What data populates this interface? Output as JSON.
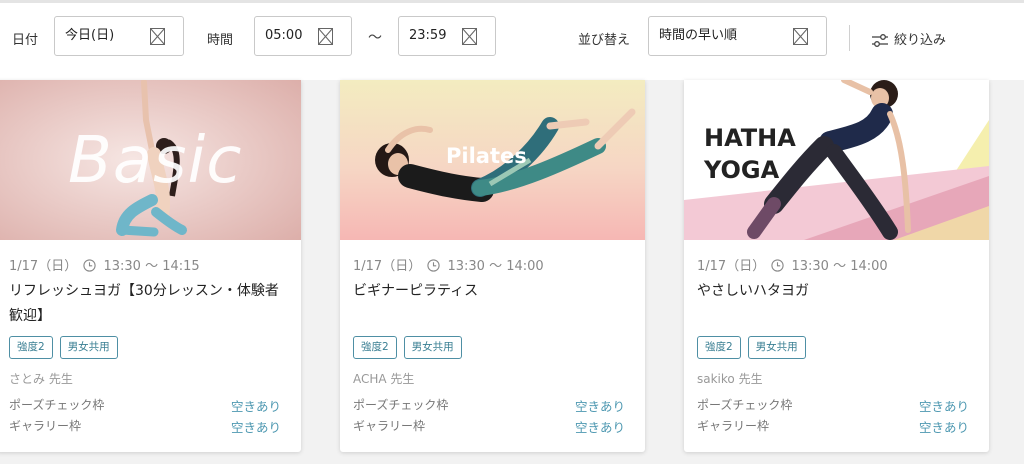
{
  "filters": {
    "date_label": "日付",
    "date_value": "今日(日)",
    "time_label": "時間",
    "time_start": "05:00",
    "time_separator": "〜",
    "time_end": "23:59",
    "sort_label": "並び替え",
    "sort_value": "時間の早い順",
    "narrow_label": "絞り込み"
  },
  "colors": {
    "accent": "#4e98b1",
    "tag": "#3a7f93"
  },
  "cards": [
    {
      "image_text": "Basic",
      "datetime": "1/17（日）",
      "time": "13:30 〜 14:15",
      "title": "リフレッシュヨガ【30分レッスン・体験者歓迎】",
      "tags": [
        "強度2",
        "男女共用"
      ],
      "teacher": "さとみ 先生",
      "slots": [
        {
          "name": "ポーズチェック枠",
          "status": "空きあり"
        },
        {
          "name": "ギャラリー枠",
          "status": "空きあり"
        }
      ]
    },
    {
      "image_text": "Pilates",
      "datetime": "1/17（日）",
      "time": "13:30 〜 14:00",
      "title": "ビギナーピラティス",
      "tags": [
        "強度2",
        "男女共用"
      ],
      "teacher": "ACHA 先生",
      "slots": [
        {
          "name": "ポーズチェック枠",
          "status": "空きあり"
        },
        {
          "name": "ギャラリー枠",
          "status": "空きあり"
        }
      ]
    },
    {
      "image_text_1": "HATHA",
      "image_text_2": "YOGA",
      "datetime": "1/17（日）",
      "time": "13:30 〜 14:00",
      "title": "やさしいハタヨガ",
      "tags": [
        "強度2",
        "男女共用"
      ],
      "teacher": "sakiko 先生",
      "slots": [
        {
          "name": "ポーズチェック枠",
          "status": "空きあり"
        },
        {
          "name": "ギャラリー枠",
          "status": "空きあり"
        }
      ]
    }
  ]
}
